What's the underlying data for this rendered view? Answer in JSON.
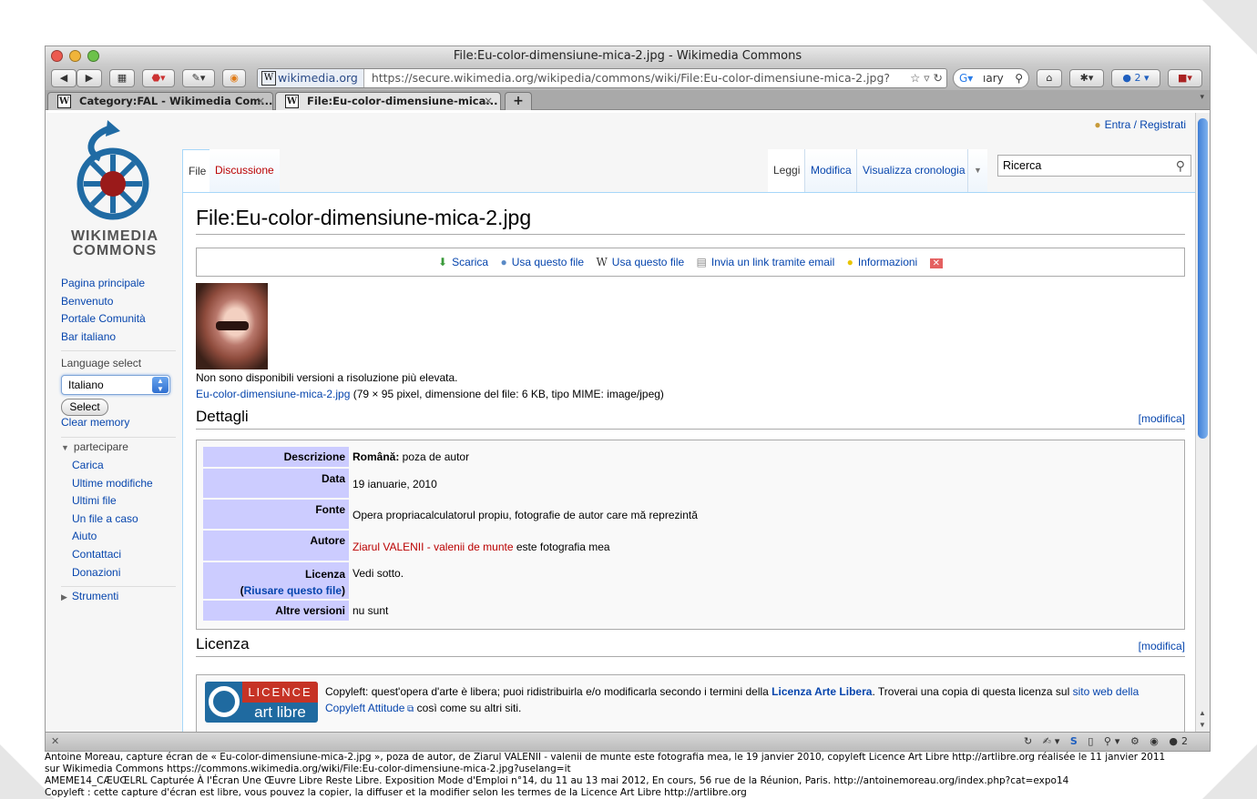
{
  "window": {
    "title": "File:Eu-color-dimensiune-mica-2.jpg - Wikimedia Commons"
  },
  "toolbar": {
    "url_site": "wikimedia.org",
    "url": "https://secure.wikimedia.org/wikipedia/commons/wiki/File:Eu-color-dimensiune-mica-2.jpg?",
    "search_text": "ıary",
    "badge_count": "2"
  },
  "tabs": [
    {
      "label": "Category:FAL - Wikimedia Com..."
    },
    {
      "label": "File:Eu-color-dimensiune-mica..."
    }
  ],
  "header": {
    "login": "Entra / Registrati"
  },
  "logo": {
    "line1": "WIKIMEDIA",
    "line2": "COMMONS"
  },
  "sidebar": {
    "main": [
      "Pagina principale",
      "Benvenuto",
      "Portale Comunità",
      "Bar italiano"
    ],
    "language_label": "Language select",
    "language_value": "Italiano",
    "select_button": "Select",
    "clear_memory": "Clear memory",
    "participate_header": "partecipare",
    "participate": [
      "Carica",
      "Ultime modifiche",
      "Ultimi file",
      "Un file a caso",
      "Aiuto",
      "Contattaci",
      "Donazioni"
    ],
    "tools": "Strumenti"
  },
  "page_tabs": {
    "file": "File",
    "discussion": "Discussione",
    "read": "Leggi",
    "edit": "Modifica",
    "history": "Visualizza cronologia",
    "search_placeholder": "Ricerca"
  },
  "content": {
    "title": "File:Eu-color-dimensiune-mica-2.jpg",
    "actions": [
      "Scarica",
      "Usa questo file",
      "Usa questo file",
      "Invia un link tramite email",
      "Informazioni"
    ],
    "no_higher_res": "Non sono disponibili versioni a risoluzione più elevata.",
    "file_link": "Eu-color-dimensiune-mica-2.jpg",
    "file_info": "(79 × 95 pixel, dimensione del file: 6 KB, tipo MIME: image/jpeg)",
    "details_heading": "Dettagli",
    "edit_link": "[modifica]",
    "license_heading": "Licenza",
    "details": {
      "descr_label": "Descrizione",
      "descr_lang": "Română:",
      "descr_value": " poza de autor",
      "date_label": "Data",
      "date_value": "19 ianuarie, 2010",
      "source_label": "Fonte",
      "source_value": "Opera propriacalculatorul propiu, fotografie de autor care mă reprezintă",
      "author_label": "Autore",
      "author_link": "Ziarul VALENII - valenii de munte",
      "author_rest": " este fotografia mea",
      "license_label": "Licenza",
      "reuse_link": "Riusare questo file",
      "license_value": "Vedi sotto.",
      "other_label": "Altre versioni",
      "other_value": "nu sunt"
    },
    "license_box": {
      "logo_top": "LICENCE",
      "logo_bottom": "art libre",
      "text_a": "Copyleft: quest'opera d'arte è libera; puoi ridistribuirla e/o modificarla secondo i termini della ",
      "link_a": "Licenza Arte Libera",
      "text_b": ". Troverai una copia di questa licenza sul ",
      "link_b": "sito web della Copyleft Attitude",
      "text_c": " così come su altri siti."
    }
  },
  "caption": {
    "line1": "Antoine Moreau, capture écran de « Eu-color-dimensiune-mica-2.jpg », poza de autor, de Ziarul VALENII - valenii de munte este fotografia mea, le 19 janvier 2010, copyleft Licence Art Libre http://artlibre.org réalisée le 11 janvier 2011",
    "line2": "sur Wikimedia Commons https://commons.wikimedia.org/wiki/File:Eu-color-dimensiune-mica-2.jpg?uselang=it",
    "line3": "AMEME14_CÆUŒLRL Capturée À l'Écran Une Œuvre Libre Reste Libre. Exposition Mode d'Emploi n°14, du 11 au 13 mai 2012, En cours, 56 rue de la Réunion, Paris. http://antoinemoreau.org/index.php?cat=expo14",
    "line4": "Copyleft : cette capture d'écran est libre, vous pouvez la copier, la diffuser et la modifier selon les termes de la Licence Art Libre http://artlibre.org"
  },
  "colors": {
    "link": "#0645ad",
    "redlink": "#ba0000",
    "label_bg": "#ccccff"
  }
}
